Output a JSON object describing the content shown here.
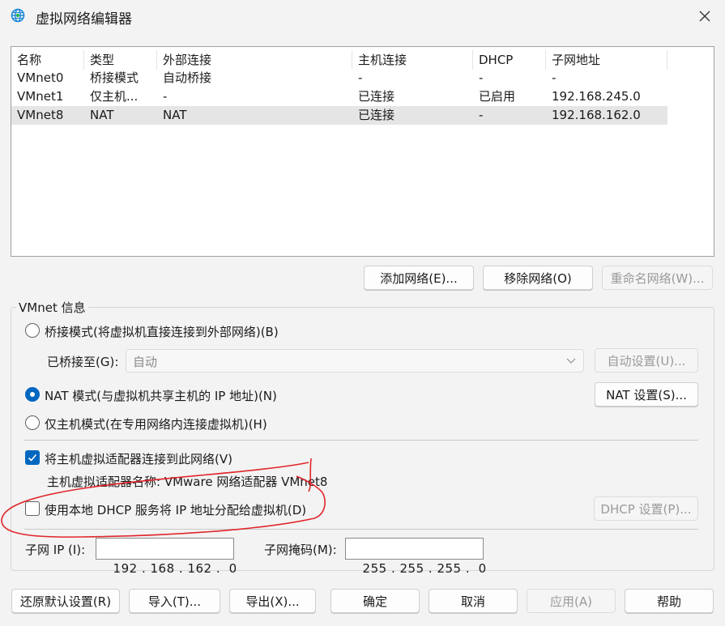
{
  "window": {
    "title": "虚拟网络编辑器",
    "icon": "globe-icon"
  },
  "network_table": {
    "columns": [
      "名称",
      "类型",
      "外部连接",
      "主机连接",
      "DHCP",
      "子网地址"
    ],
    "rows": [
      {
        "name": "VMnet0",
        "type": "桥接模式",
        "external": "自动桥接",
        "host": "-",
        "dhcp": "-",
        "subnet": "-",
        "selected": false
      },
      {
        "name": "VMnet1",
        "type": "仅主机...",
        "external": "-",
        "host": "已连接",
        "dhcp": "已启用",
        "subnet": "192.168.245.0",
        "selected": false
      },
      {
        "name": "VMnet8",
        "type": "NAT",
        "external": "NAT",
        "host": "已连接",
        "dhcp": "-",
        "subnet": "192.168.162.0",
        "selected": true
      }
    ]
  },
  "list_buttons": {
    "add": "添加网络(E)...",
    "remove": "移除网络(O)",
    "rename": "重命名网络(W)..."
  },
  "vmnet_info": {
    "legend": "VMnet 信息",
    "bridged_label": "桥接模式(将虚拟机直接连接到外部网络)(B)",
    "bridged_to_label": "已桥接至(G):",
    "bridged_to_value": "自动",
    "auto_settings": "自动设置(U)...",
    "nat_label": "NAT 模式(与虚拟机共享主机的 IP 地址)(N)",
    "nat_settings": "NAT 设置(S)...",
    "hostonly_label": "仅主机模式(在专用网络内连接虚拟机)(H)",
    "selected_mode": "nat",
    "connect_adapter_label": "将主机虚拟适配器连接到此网络(V)",
    "connect_adapter_checked": true,
    "adapter_name_label": "主机虚拟适配器名称: VMware 网络适配器 VMnet8",
    "dhcp_label": "使用本地 DHCP 服务将 IP 地址分配给虚拟机(D)",
    "dhcp_checked": false,
    "dhcp_settings": "DHCP 设置(P)...",
    "subnet_ip_label": "子网 IP (I):",
    "subnet_ip": [
      "192",
      "168",
      "162",
      "0"
    ],
    "subnet_mask_label": "子网掩码(M):",
    "subnet_mask": [
      "255",
      "255",
      "255",
      "0"
    ]
  },
  "bottom_buttons": {
    "restore": "还原默认设置(R)",
    "import": "导入(T)...",
    "export": "导出(X)...",
    "ok": "确定",
    "cancel": "取消",
    "apply": "应用(A)",
    "help": "帮助"
  },
  "colors": {
    "accent": "#0067c0",
    "annotation": "#e0262b",
    "selected_row": "#e5e5e5"
  }
}
